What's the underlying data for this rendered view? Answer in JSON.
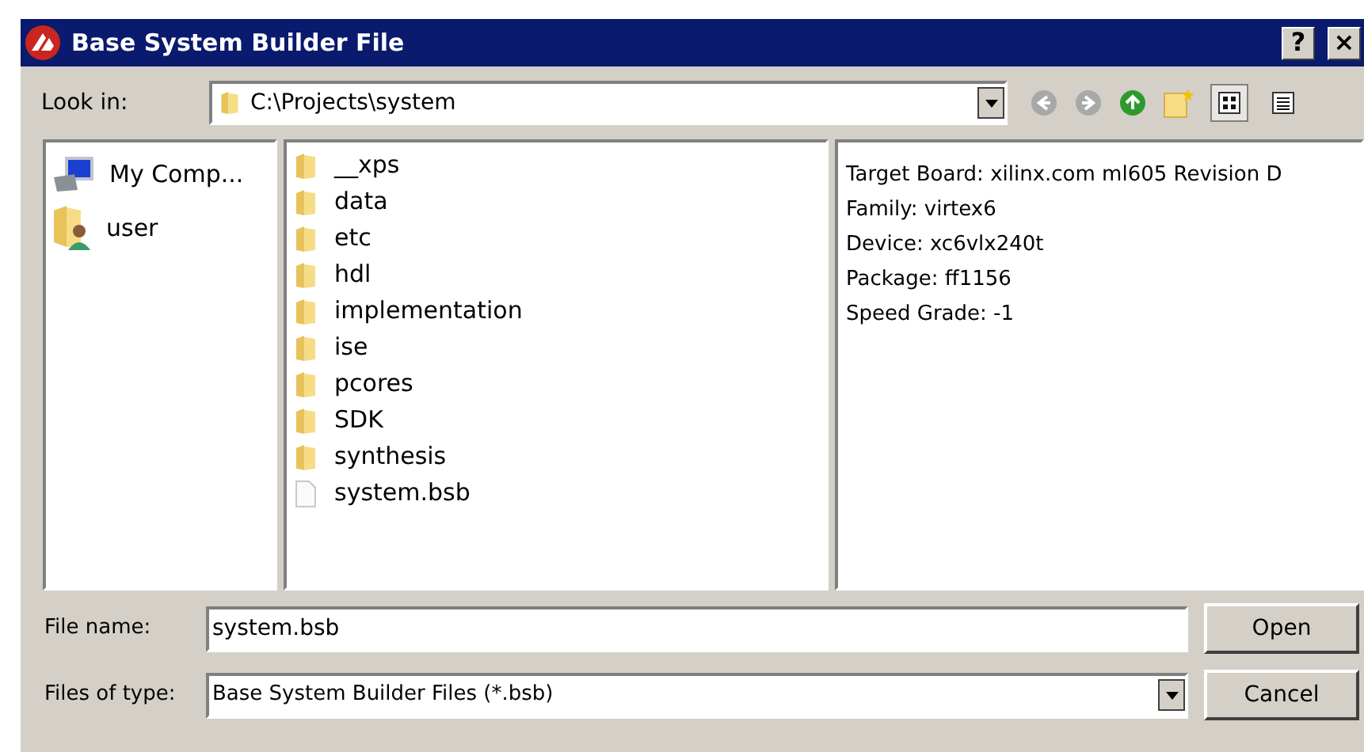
{
  "window": {
    "title": "Base System Builder File",
    "buttons": [
      {
        "label": "?"
      },
      {
        "label": "×"
      }
    ]
  },
  "look_in": {
    "label": "Look in:",
    "value": "C:\\Projects\\system"
  },
  "toolbar": [
    {
      "kind": "back",
      "disabled": true
    },
    {
      "kind": "forward",
      "disabled": true
    },
    {
      "kind": "up",
      "disabled": false
    },
    {
      "kind": "new-folder"
    },
    {
      "kind": "list-view",
      "selected": true
    },
    {
      "kind": "detail-view",
      "selected": false
    }
  ],
  "sidebar": {
    "items": [
      {
        "kind": "computer",
        "label": "My Comp..."
      },
      {
        "kind": "user",
        "label": "user"
      }
    ]
  },
  "files": [
    {
      "kind": "folder",
      "name": "__xps"
    },
    {
      "kind": "folder",
      "name": "data"
    },
    {
      "kind": "folder",
      "name": "etc"
    },
    {
      "kind": "folder",
      "name": "hdl"
    },
    {
      "kind": "folder",
      "name": "implementation"
    },
    {
      "kind": "folder",
      "name": "ise"
    },
    {
      "kind": "folder",
      "name": "pcores"
    },
    {
      "kind": "folder",
      "name": "SDK"
    },
    {
      "kind": "folder",
      "name": "synthesis"
    },
    {
      "kind": "file",
      "name": "system.bsb"
    }
  ],
  "preview": [
    "Target Board: xilinx.com ml605 Revision D",
    "Family: virtex6",
    "Device: xc6vlx240t",
    "Package: ff1156",
    "Speed Grade: -1"
  ],
  "file_name": {
    "label": "File name:",
    "value": "system.bsb"
  },
  "file_type": {
    "label": "Files of type:",
    "value": "Base System Builder Files (*.bsb)"
  },
  "buttons": [
    {
      "label": "Open"
    },
    {
      "label": "Cancel"
    }
  ]
}
